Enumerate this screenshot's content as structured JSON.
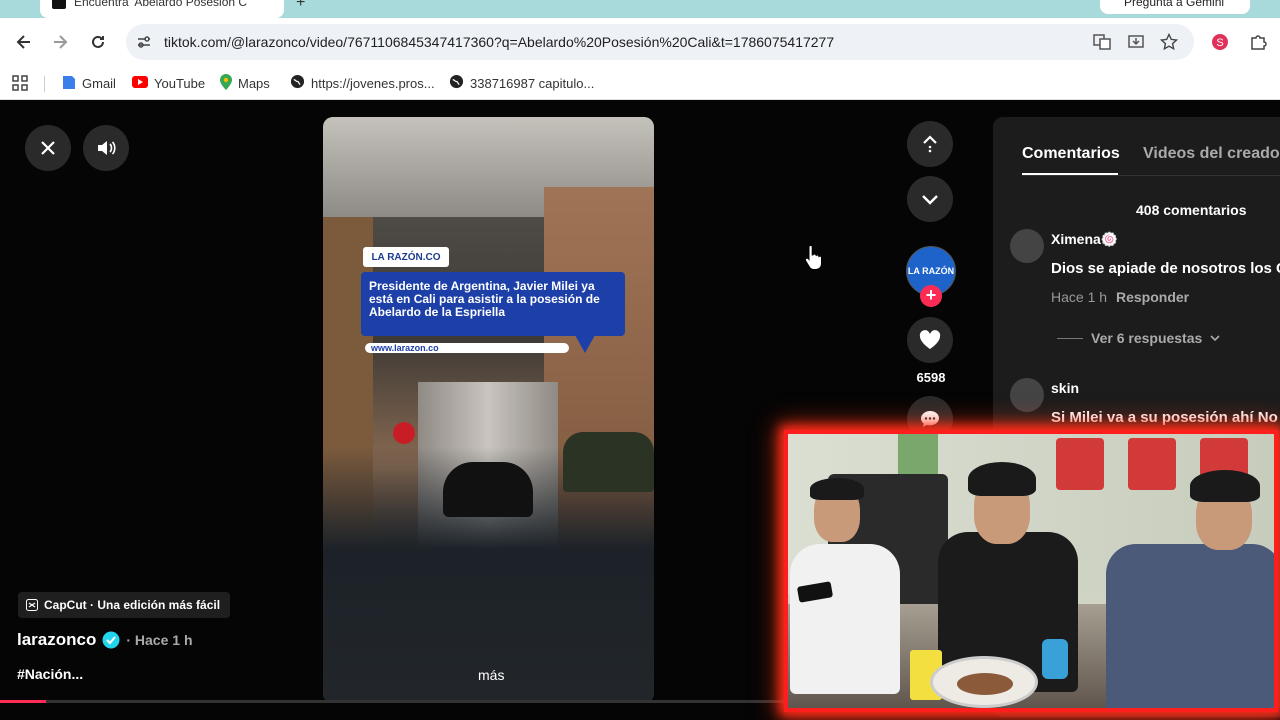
{
  "browser": {
    "tab_title": "Encuentra 'Abelardo Posesión C",
    "gemini_label": "Pregunta a Gemini",
    "url": "tiktok.com/@larazonco/video/7671106845347417360?q=Abelardo%20Posesión%20Cali&t=1786075417277",
    "bookmarks": [
      {
        "label": "Gmail",
        "icon": "gmail-icon"
      },
      {
        "label": "YouTube",
        "icon": "youtube-icon"
      },
      {
        "label": "Maps",
        "icon": "maps-icon"
      },
      {
        "label": "https://jovenes.pros...",
        "icon": "globe-icon"
      },
      {
        "label": "338716987 capitulo...",
        "icon": "globe-icon"
      }
    ]
  },
  "video": {
    "logo_text": "LA RAZÓN.CO",
    "headline": "Presidente de Argentina, Javier Milei ya está en Cali para asistir a la posesión de Abelardo de la Espriella",
    "site_url": "www.larazon.co",
    "more_label": "más",
    "progress_fraction": 0.036
  },
  "capcut": {
    "label": "CapCut · Una edición más fácil"
  },
  "author": {
    "name": "larazonco",
    "time": "· Hace 1 h",
    "hashtag": "#Nación..."
  },
  "actions": {
    "likes": "6598",
    "avatar_text": "LA RAZÓN"
  },
  "comments": {
    "tab_comments": "Comentarios",
    "tab_creator_videos": "Videos del creador",
    "count_label": "408 comentarios",
    "view_replies": "Ver 6 respuestas",
    "items": [
      {
        "user": "Ximena🍥",
        "text": "Dios se apiade de nosotros los C",
        "time": "Hace 1 h",
        "reply": "Responder"
      },
      {
        "user": "skin",
        "text": "Si Milei va a su posesión ahí No"
      }
    ]
  },
  "colors": {
    "accent": "#fe2c55",
    "headline_bg": "#1c3fa8",
    "webcam_border": "#ff1e1e"
  }
}
